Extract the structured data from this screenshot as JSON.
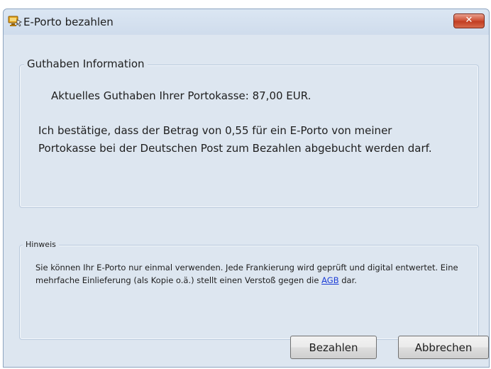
{
  "window": {
    "title": "E-Porto bezahlen",
    "title_icon": "postage-computer-icon",
    "close_label": "✕",
    "close_color": "#c8432a"
  },
  "guthaben": {
    "heading": "Guthaben Information",
    "balance_text": "Aktuelles Guthaben Ihrer Portokasse:  87,00 EUR.",
    "confirm_text": "Ich bestätige, dass der Betrag von 0,55 für ein E-Porto von meiner Portokasse bei der Deutschen Post zum Bezahlen abgebucht werden darf."
  },
  "hinweis": {
    "heading": "Hinweis",
    "text_before_link": "Sie können Ihr E-Porto nur einmal verwenden. Jede Frankierung wird geprüft und digital entwertet. Eine mehrfache Einlieferung (als Kopie o.ä.) stellt einen Verstoß gegen die ",
    "link_text": "AGB",
    "text_after_link": " dar."
  },
  "buttons": {
    "pay_label": "Bezahlen",
    "cancel_label": "Abbrechen"
  }
}
